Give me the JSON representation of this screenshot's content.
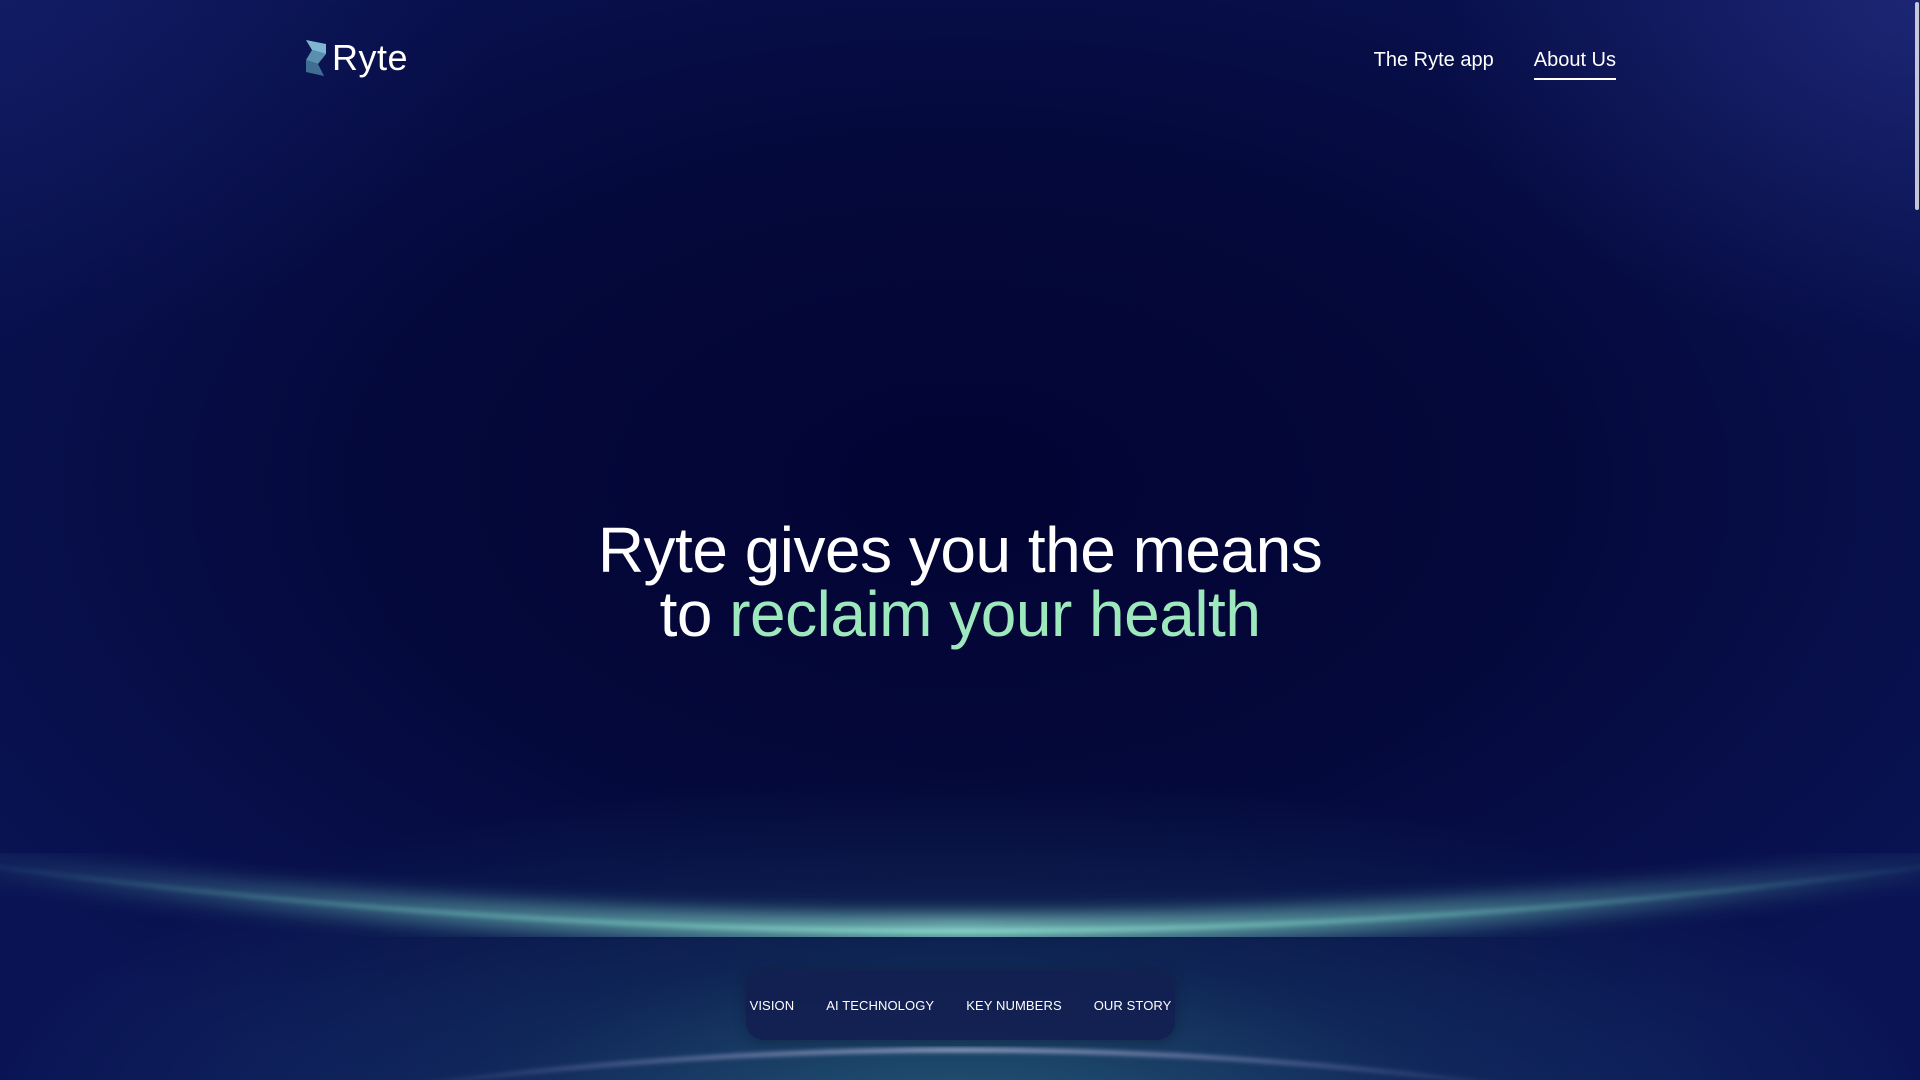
{
  "header": {
    "logo_text": "Ryte",
    "nav": [
      {
        "label": "The Ryte app",
        "active": false
      },
      {
        "label": "About Us",
        "active": true
      }
    ]
  },
  "hero": {
    "line1": "Ryte gives you the means",
    "line2_prefix": "to",
    "line2_accent": "reclaim your health"
  },
  "section_tabs": [
    {
      "label": "VISION"
    },
    {
      "label": "AI TECHNOLOGY"
    },
    {
      "label": "KEY NUMBERS"
    },
    {
      "label": "OUR STORY"
    }
  ],
  "colors": {
    "background": "#040734",
    "accent": "#9ee8bd",
    "text": "#ffffff",
    "tabbar": "#122050"
  },
  "icons": {
    "logo": "ryte-logo-icon"
  }
}
